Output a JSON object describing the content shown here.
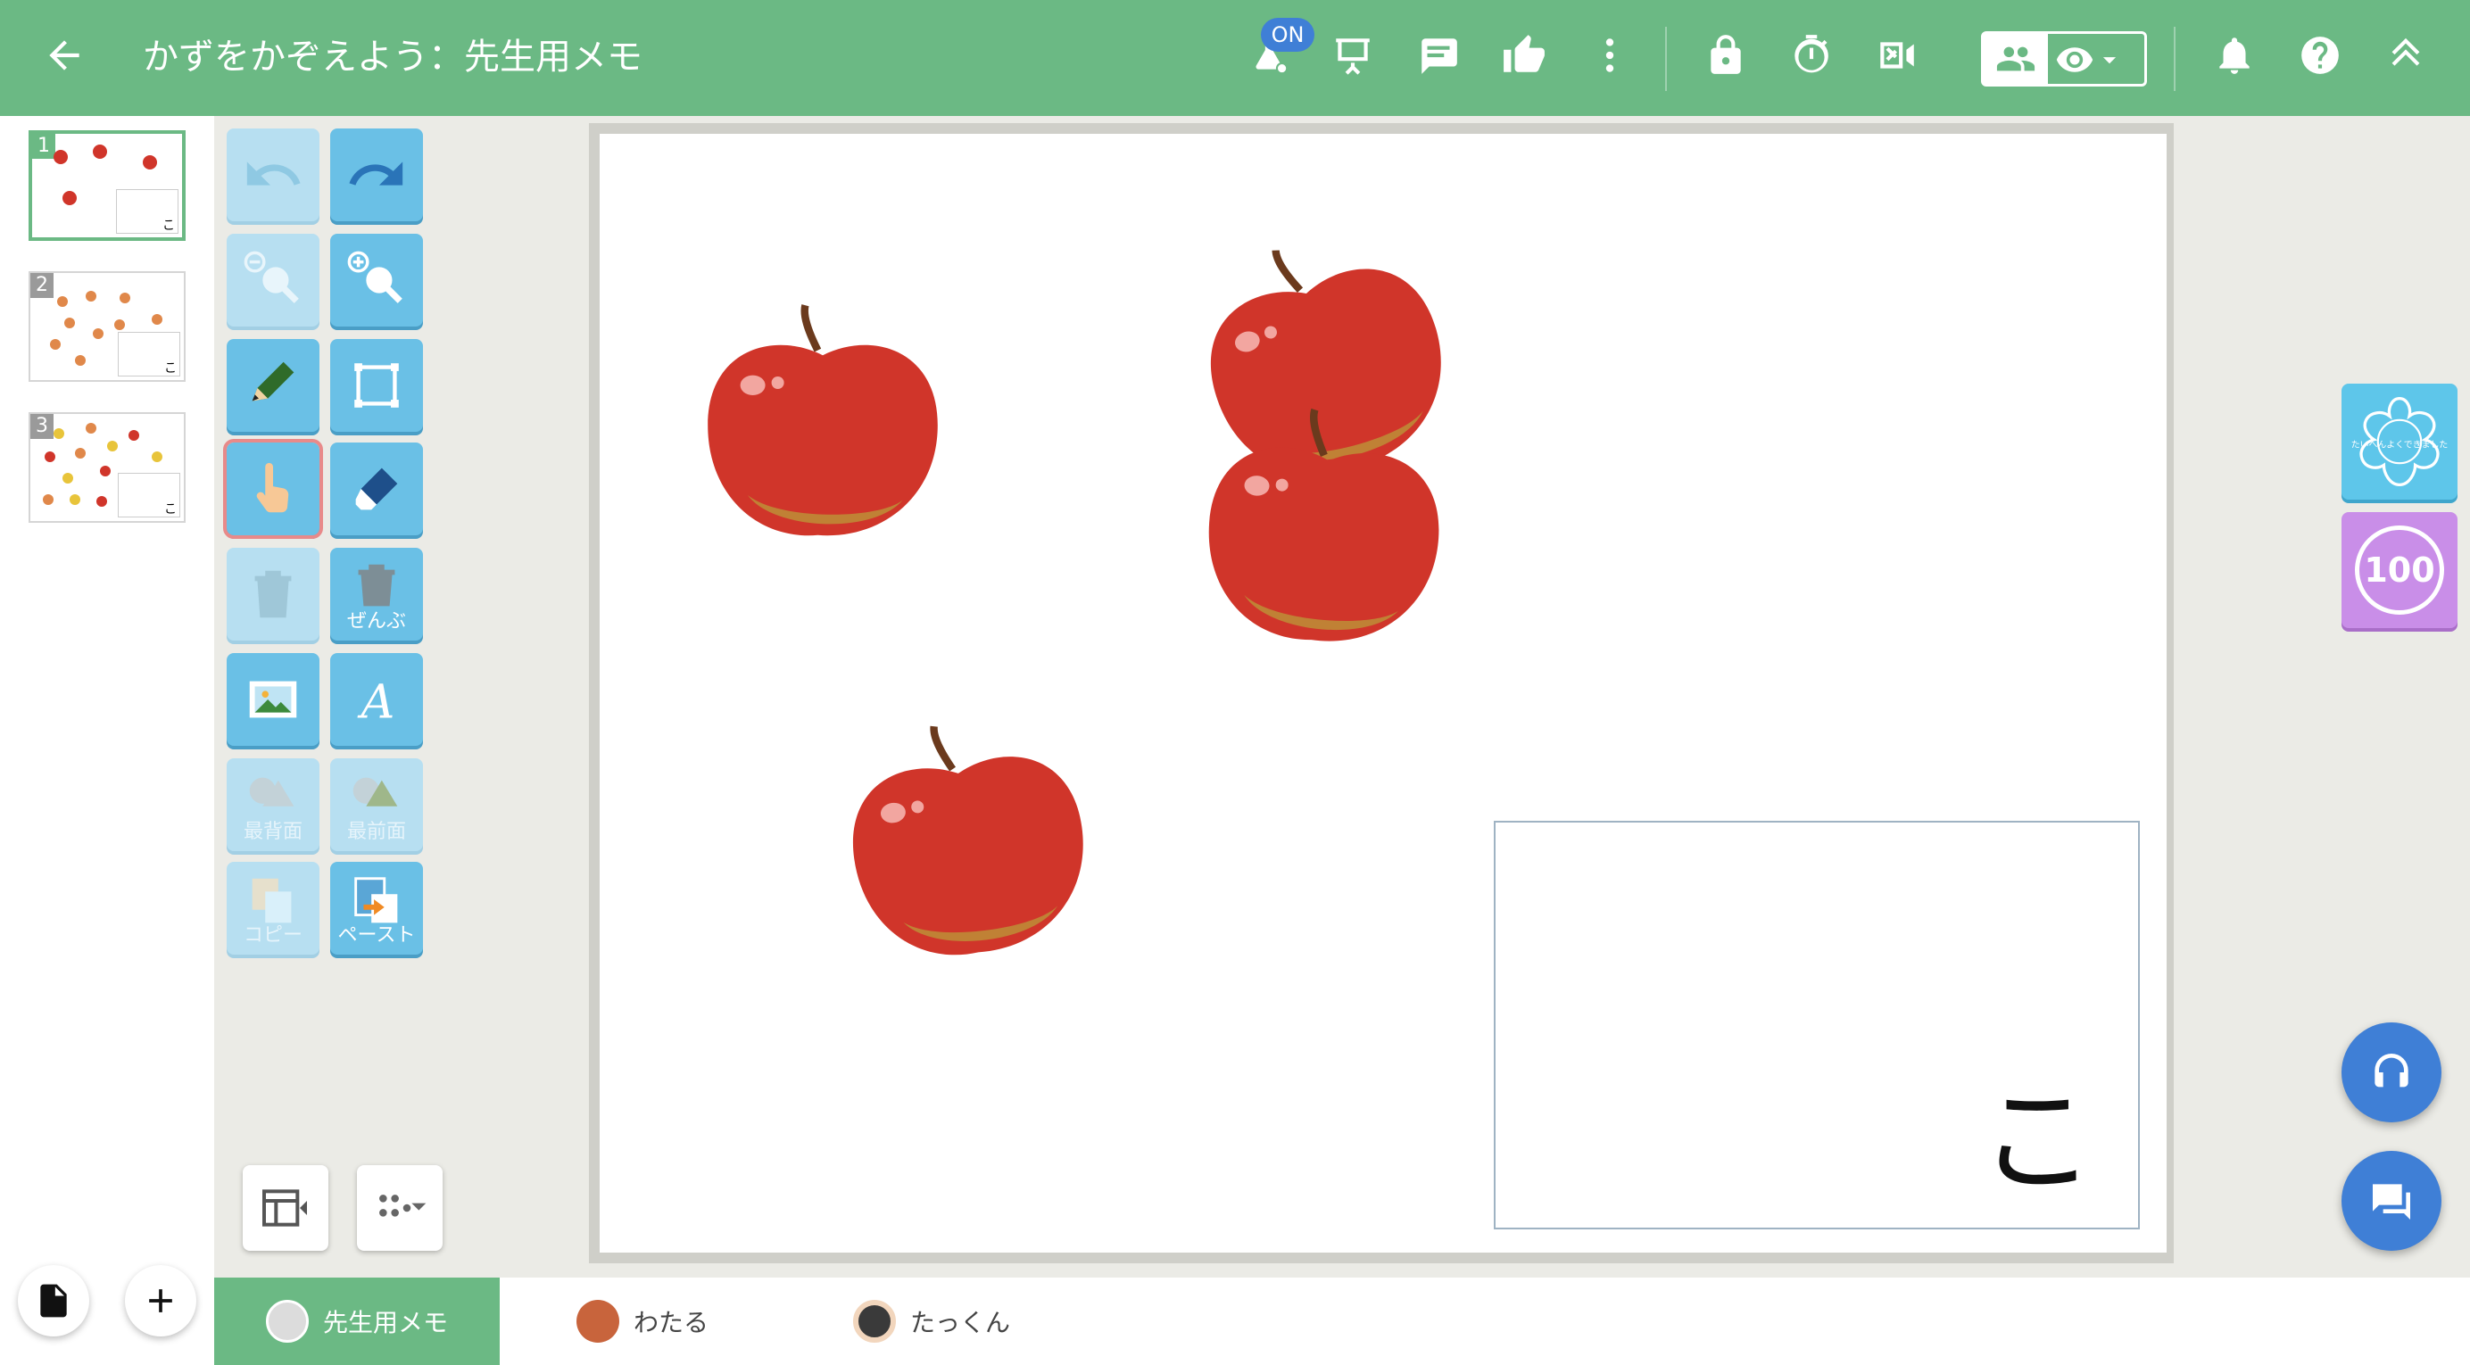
{
  "header": {
    "title": "かずをかぞえよう：先生用メモ",
    "on_badge": "ON"
  },
  "slides": [
    {
      "number": "1",
      "corner_text": "こ"
    },
    {
      "number": "2",
      "corner_text": "こ"
    },
    {
      "number": "3",
      "corner_text": "こ"
    }
  ],
  "toolbar": {
    "delete_all_label": "ぜんぶ",
    "send_back_label": "最背面",
    "bring_front_label": "最前面",
    "copy_label": "コピー",
    "paste_label": "ペースト"
  },
  "canvas": {
    "answer_text": "こ"
  },
  "side": {
    "stamp_text": "たいへんよくできました",
    "score_badge": "100"
  },
  "tabs": [
    {
      "label": "先生用メモ"
    },
    {
      "label": "わたる"
    },
    {
      "label": "たっくん"
    }
  ],
  "colors": {
    "header_green": "#6bb984",
    "tool_blue": "#6ac0e6",
    "fab_blue": "#3f7fd6",
    "score_purple": "#c98ee8",
    "apple_red": "#d0352a"
  }
}
